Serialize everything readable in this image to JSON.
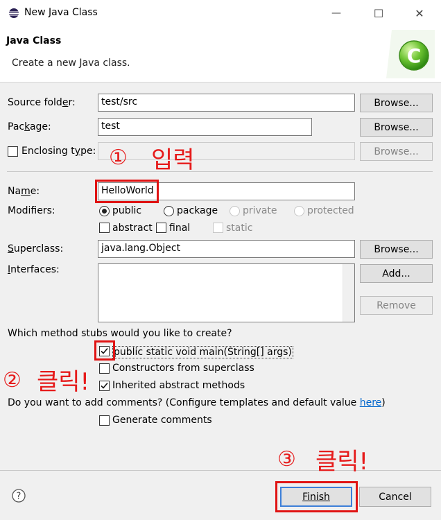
{
  "window": {
    "title": "New Java Class",
    "min_glyph": "—",
    "max_glyph": "☐",
    "close_glyph": "✕"
  },
  "header": {
    "title": "Java Class",
    "description": "Create a new Java class."
  },
  "form": {
    "source_folder": {
      "label_pre": "Source fold",
      "label_u": "e",
      "label_post": "r:",
      "value": "test/src",
      "browse": "Browse..."
    },
    "package": {
      "label_pre": "Pac",
      "label_u": "k",
      "label_post": "age:",
      "value": "test",
      "browse": "Browse..."
    },
    "enclosing": {
      "label_pre": "Enclosing t",
      "label_u": "y",
      "label_post": "pe:",
      "value": "",
      "browse": "Browse..."
    },
    "name": {
      "label_pre": "Na",
      "label_u": "m",
      "label_post": "e:",
      "value": "HelloWorld"
    },
    "modifiers": {
      "label": "Modifiers:",
      "public": "public",
      "package": "package",
      "private": "private",
      "protected": "protected",
      "abstract": "abstract",
      "final": "final",
      "static": "static"
    },
    "superclass": {
      "label_u": "S",
      "label_post": "uperclass:",
      "value": "java.lang.Object",
      "browse": "Browse..."
    },
    "interfaces": {
      "label_u": "I",
      "label_post": "nterfaces:",
      "add": "Add...",
      "remove": "Remove"
    },
    "stubs": {
      "question": "Which method stubs would you like to create?",
      "main": "public static void main(String[] args)",
      "constructors": "Constructors from superclass",
      "inherited": "Inherited abstract methods"
    },
    "comments": {
      "question": "Do you want to add comments? (Configure templates and default value ",
      "link": "here",
      "question_end": ")",
      "generate": "Generate comments"
    }
  },
  "annotations": {
    "step1_num": "①",
    "step1_text": "입력",
    "step2_num": "②",
    "step2_text": "클릭!",
    "step3_num": "③",
    "step3_text": "클릭!"
  },
  "footer": {
    "help": "?",
    "finish": "Finish",
    "cancel": "Cancel"
  },
  "colors": {
    "annotation_red": "#e61b1b",
    "link_blue": "#0066cc",
    "focus_blue": "#3c7fd8"
  }
}
